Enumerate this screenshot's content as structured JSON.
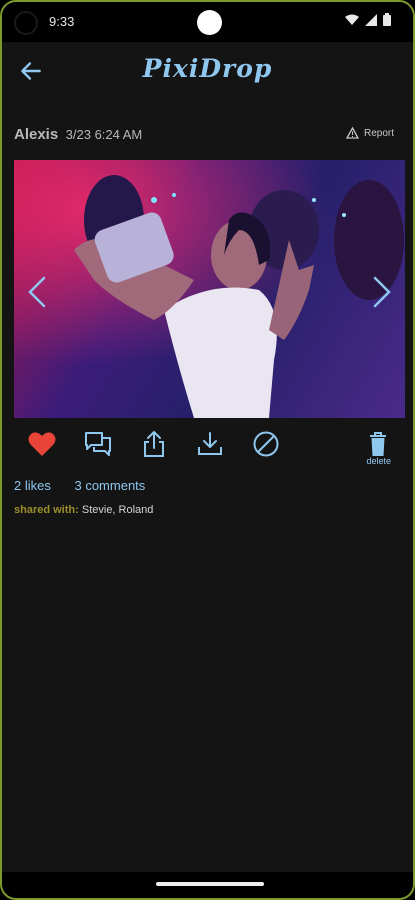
{
  "status_bar": {
    "time": "9:33"
  },
  "app": {
    "title": "PixiDrop"
  },
  "post": {
    "user": "Alexis",
    "timestamp": "3/23 6:24 AM",
    "report_label": "Report"
  },
  "actions": {
    "delete_label": "delete"
  },
  "stats": {
    "likes": "2 likes",
    "comments": "3 comments"
  },
  "shared": {
    "label": "shared with:",
    "names": "Stevie, Roland"
  },
  "colors": {
    "accent": "#8fc7ef",
    "like": "#e8443a",
    "shared_label": "#9a8f2a",
    "background": "#141414"
  },
  "icons": [
    "back-arrow-icon",
    "warning-icon",
    "chevron-left-icon",
    "chevron-right-icon",
    "heart-icon",
    "comments-icon",
    "share-icon",
    "download-icon",
    "block-icon",
    "trash-icon",
    "wifi-icon",
    "signal-icon",
    "battery-icon"
  ]
}
